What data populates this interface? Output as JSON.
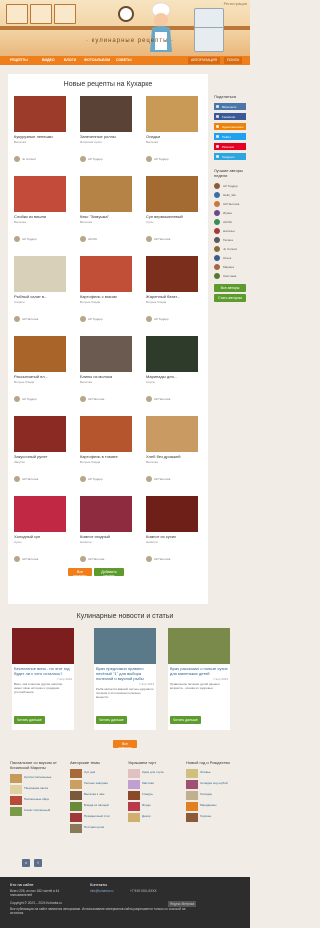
{
  "header": {
    "logo": "· кулинарные рецепты ·",
    "top_link": "Регистрация"
  },
  "nav": {
    "items": [
      "РЕЦЕПТЫ",
      "ВИДЕО",
      "БЛОГИ",
      "ФОТОАЛЬБОМ",
      "СОВЕТЫ"
    ],
    "right": [
      "АВТОРИЗАЦИЯ",
      "ПОИСК"
    ]
  },
  "main": {
    "section_title": "Новые рецепты на Кухарке",
    "cards": [
      {
        "title": "Кукурузные лепешки",
        "sub": "Выпечка",
        "user": "Ju Cursed",
        "color": "#9c3b2a"
      },
      {
        "title": "Запеченные роллы",
        "sub": "Японская кухня",
        "user": "Ай Тоддер",
        "color": "#5a4336"
      },
      {
        "title": "Оладьи",
        "sub": "Выпечка",
        "user": "Ай Тоддер",
        "color": "#c89a55"
      },
      {
        "title": "Слойки из вишни",
        "sub": "Выпечка",
        "user": "Ай Тоддер",
        "color": "#c24b3a"
      },
      {
        "title": "Кекс \"Зимушка\"",
        "sub": "Выпечка",
        "user": "Ай МА",
        "color": "#b58346"
      },
      {
        "title": "Суп вермишелевый",
        "sub": "Супы",
        "user": "Ай Палочка",
        "color": "#a36a32"
      },
      {
        "title": "Рыбный салат в...",
        "sub": "Салаты",
        "user": "Ай Палочка",
        "color": "#d8d0b8"
      },
      {
        "title": "Картофель с мясом",
        "sub": "Вторые блюда",
        "user": "Ай Тоддер",
        "color": "#c14e36"
      },
      {
        "title": "Жаренный батат...",
        "sub": "Вторые блюда",
        "user": "Ай Тоддер",
        "color": "#7c2e1d"
      },
      {
        "title": "Рассыпчатый пл...",
        "sub": "Вторые блюда",
        "user": "Ай Тоддер",
        "color": "#a86429"
      },
      {
        "title": "Блины из молока",
        "sub": "Выпечка",
        "user": "Ай Палочка",
        "color": "#6b5a4f"
      },
      {
        "title": "Маринады для...",
        "sub": "Соусы",
        "user": "Ай Палочка",
        "color": "#2f3b2a"
      },
      {
        "title": "Закусочный рулет",
        "sub": "Закуски",
        "user": "Ай Палочка",
        "color": "#8b2a22"
      },
      {
        "title": "Картофель в томате",
        "sub": "Вторые блюда",
        "user": "Ай Тоддер",
        "color": "#b5552d"
      },
      {
        "title": "Хлеб без дрожжей",
        "sub": "Выпечка",
        "user": "Ай Палочка",
        "color": "#c99b62"
      },
      {
        "title": "Холодный суп",
        "sub": "Супы",
        "user": "Ай Палочка",
        "color": "#c12844"
      },
      {
        "title": "Компот ягодный",
        "sub": "Напитки",
        "user": "Ай Палочка",
        "color": "#8e2b3e"
      },
      {
        "title": "Компот из сухих",
        "sub": "Напитки",
        "user": "Ай Палочка",
        "color": "#6e1f18"
      }
    ],
    "more_button": "Все рецепты",
    "add_button": "Добавить рецепт"
  },
  "sidebar": {
    "share_title": "Поделиться",
    "share": [
      {
        "label": "ВКонтакте",
        "color": "#4a76a8"
      },
      {
        "label": "Facebook",
        "color": "#3b5998"
      },
      {
        "label": "Одноклассники",
        "color": "#ee8208"
      },
      {
        "label": "Twitter",
        "color": "#1da1f2"
      },
      {
        "label": "Pinterest",
        "color": "#e60023"
      },
      {
        "label": "Telegram",
        "color": "#2ca5e0"
      }
    ],
    "authors_title": "Лучшие авторы недели",
    "authors": [
      "Ай Тоддер",
      "Hello_Wo",
      "Ай Палочка",
      "Ирина",
      "Ай МА",
      "Наталья",
      "Галина",
      "Ju Cursed",
      "Ольга",
      "Марина",
      "Светлана"
    ],
    "author_colors": [
      "#8a5a3a",
      "#3a6ea5",
      "#c97a3a",
      "#6b4a8a",
      "#3a8a5a",
      "#a53a3a",
      "#5a5a5a",
      "#8a6a3a",
      "#3a5a8a",
      "#aa6644",
      "#557733"
    ],
    "all_button": "Все авторы",
    "rating_button": "Стать автором"
  },
  "news": {
    "section_title": "Кулинарные новости и статьи",
    "items": [
      {
        "title": "Бесплатное вино - но этот год будет ли с чего осталось?",
        "date": "7 апр 2023",
        "text": "Вино, как и многие другие напитки, имеет свою историю и традиции употребления.",
        "button": "Читать дальше",
        "color": "#7c1e1e"
      },
      {
        "title": "Врач предложил правило печёный \"1\" для выбора полезной и вкусной рыбы",
        "date": "7 апр 2023",
        "text": "Рыба является важной частью здорового питания и источником полезных веществ.",
        "button": "Читать дальше",
        "color": "#5a7a8a"
      },
      {
        "title": "Врач рассказал о пользе сухих для маленьких детей",
        "date": "7 апр 2023",
        "text": "Правильное питание детей раннего возраста - основа их здоровья.",
        "button": "Читать дальше",
        "color": "#7a8a4a"
      }
    ],
    "more_button": "Все новости"
  },
  "footer_cols": [
    {
      "title": "Пасхальное со вкусом от Кичанской Марины",
      "items": [
        "Куличи пасхальные",
        "Творожная пасха",
        "Пасхальные яйца",
        "Салат пасхальный"
      ],
      "colors": [
        "#c69a5a",
        "#e0d0a0",
        "#b84a3a",
        "#7a9a4a"
      ]
    },
    {
      "title": "Авторские темы",
      "items": [
        "Суп дня",
        "Уютные завтраки",
        "Выпечка к чаю",
        "Блюда из овощей",
        "Праздничный стол",
        "Постная кухня"
      ],
      "colors": [
        "#a86a3a",
        "#c9a060",
        "#7a5a3a",
        "#6a8a3a",
        "#a03a3a",
        "#8a7a5a"
      ]
    },
    {
      "title": "Украшаем торт",
      "items": [
        "Крем для торта",
        "Мастика",
        "Глазурь",
        "Ягоды",
        "Декор"
      ],
      "colors": [
        "#e0c0c0",
        "#c0a0d0",
        "#8a4a2a",
        "#b83a4a",
        "#d0b070"
      ]
    },
    {
      "title": "Новый год и Рождество",
      "items": [
        "Оливье",
        "Селёдка под шубой",
        "Холодец",
        "Мандарины",
        "Горячее"
      ],
      "colors": [
        "#d0c080",
        "#a05070",
        "#c0b090",
        "#e08020",
        "#8a5a3a"
      ]
    }
  ],
  "footer": {
    "about_title": "Кто на сайте",
    "about_text": "Всего 226, из них 182 гостей и 44 пользователей",
    "contacts_title": "Контакты",
    "email": "info@kuharka.ru",
    "phone": "+7 919 XXX-XXXX",
    "copyright": "Copyright © 2023 – 2024 Kuharka.ru",
    "copyright2": "Все публикации на сайте являются авторскими. Использование материалов сайта разрешается только со ссылкой на источник.",
    "badge": "Яндекс Метрика"
  }
}
